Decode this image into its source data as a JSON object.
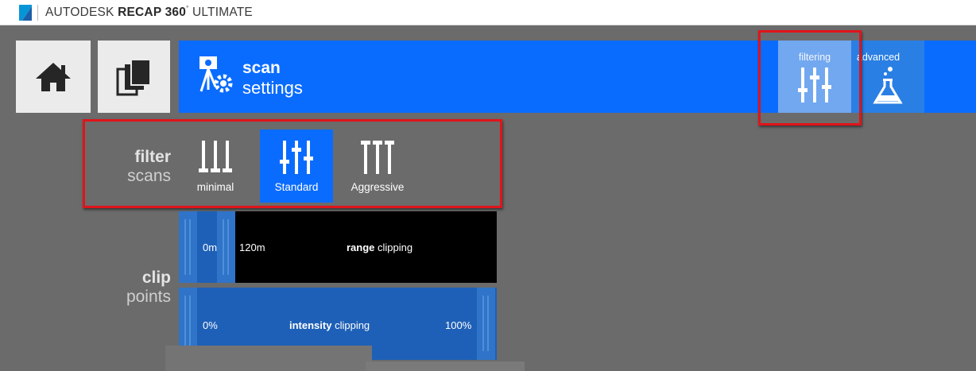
{
  "app": {
    "brand": "AUTODESK",
    "product": "RECAP 360",
    "trademark": "°",
    "edition": "ULTIMATE"
  },
  "nav": {
    "home_icon": "home-icon",
    "pages_icon": "copy-pages-icon"
  },
  "header": {
    "icon": "scan-settings-icon",
    "title": "scan",
    "subtitle": "settings"
  },
  "tabs": [
    {
      "label": "filtering",
      "icon": "sliders-icon",
      "selected": true
    },
    {
      "label": "advanced",
      "icon": "flask-icon",
      "selected": false
    }
  ],
  "filter": {
    "title": "filter",
    "subtitle": "scans",
    "options": [
      {
        "label": "minimal",
        "icon": "sliders-minimal-icon",
        "selected": false
      },
      {
        "label": "Standard",
        "icon": "sliders-standard-icon",
        "selected": true
      },
      {
        "label": "Aggressive",
        "icon": "sliders-aggressive-icon",
        "selected": false
      }
    ]
  },
  "clip": {
    "title": "clip",
    "subtitle": "points",
    "range": {
      "min_label": "0m",
      "max_label": "120m",
      "name_bold": "range",
      "name_rest": " clipping"
    },
    "intensity": {
      "min_label": "0%",
      "max_label": "100%",
      "name_bold": "intensity",
      "name_rest": " clipping"
    }
  },
  "colors": {
    "accent": "#0a6cff",
    "highlight": "#e0141a",
    "background": "#6b6b6b"
  }
}
